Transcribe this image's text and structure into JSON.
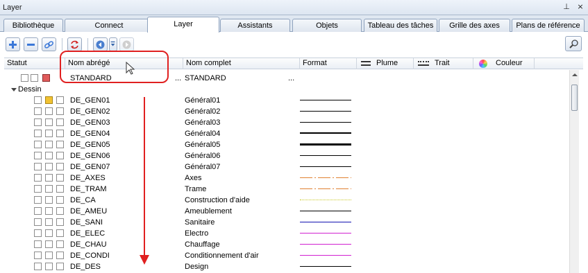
{
  "window": {
    "title": "Layer",
    "pin_symbol": "⊥",
    "close_symbol": "×"
  },
  "tabs": [
    {
      "label": "Bibliothèque",
      "active": false
    },
    {
      "label": "Connect",
      "active": false
    },
    {
      "label": "Layer",
      "active": true
    },
    {
      "label": "Assistants",
      "active": false
    },
    {
      "label": "Objets",
      "active": false
    },
    {
      "label": "Tableau des tâches",
      "active": false
    },
    {
      "label": "Grille des axes",
      "active": false
    },
    {
      "label": "Plans de référence",
      "active": false
    }
  ],
  "toolbar": {
    "icons": [
      "add-layer-icon",
      "remove-layer-icon",
      "link-icon",
      "refresh-icon",
      "navigate-icon",
      "dropdown-icon",
      "disabled-action-icon",
      "search-icon"
    ]
  },
  "columns": {
    "statut": "Statut",
    "nom_abrege": "Nom abrégé",
    "nom_complet": "Nom complet",
    "format": "Format",
    "plume": "Plume",
    "trait": "Trait",
    "couleur": "Couleur"
  },
  "standard_row": {
    "short": "STANDARD",
    "full": "STANDARD",
    "ellipsis": "...",
    "ellipsis2": "..."
  },
  "group": {
    "label": "Dessin"
  },
  "rows": [
    {
      "short": "DE_GEN01",
      "full": "Général01",
      "line": "solid-thin",
      "color": "#000000",
      "status2": "yellow"
    },
    {
      "short": "DE_GEN02",
      "full": "Général02",
      "line": "solid-thin",
      "color": "#000000"
    },
    {
      "short": "DE_GEN03",
      "full": "Général03",
      "line": "solid-thin",
      "color": "#000000"
    },
    {
      "short": "DE_GEN04",
      "full": "Général04",
      "line": "solid-medium",
      "color": "#000000"
    },
    {
      "short": "DE_GEN05",
      "full": "Général05",
      "line": "solid-thick",
      "color": "#000000"
    },
    {
      "short": "DE_GEN06",
      "full": "Général06",
      "line": "solid-thin",
      "color": "#000000"
    },
    {
      "short": "DE_GEN07",
      "full": "Général07",
      "line": "solid-thin",
      "color": "#000000"
    },
    {
      "short": "DE_AXES",
      "full": "Axes",
      "line": "dashdot",
      "color": "#e08030"
    },
    {
      "short": "DE_TRAM",
      "full": "Trame",
      "line": "dashdot",
      "color": "#e08030"
    },
    {
      "short": "DE_CA",
      "full": "Construction d'aide",
      "line": "dotted",
      "color": "#c8c820"
    },
    {
      "short": "DE_AMEU",
      "full": "Ameublement",
      "line": "solid-thin",
      "color": "#000000"
    },
    {
      "short": "DE_SANI",
      "full": "Sanitaire",
      "line": "solid-thin",
      "color": "#1010b0"
    },
    {
      "short": "DE_ELEC",
      "full": "Electro",
      "line": "solid-thin",
      "color": "#d020d0"
    },
    {
      "short": "DE_CHAU",
      "full": "Chauffage",
      "line": "solid-thin",
      "color": "#d020d0"
    },
    {
      "short": "DE_CONDI",
      "full": "Conditionnement d'air",
      "line": "solid-thin",
      "color": "#d020d0"
    },
    {
      "short": "DE_DES",
      "full": "Design",
      "line": "solid-thin",
      "color": "#000000"
    }
  ]
}
